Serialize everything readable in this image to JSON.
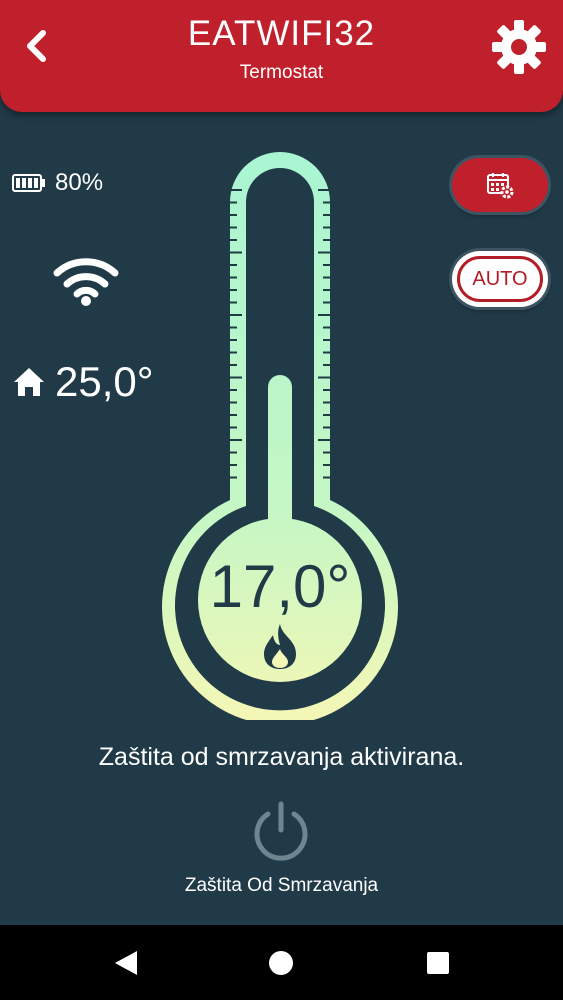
{
  "header": {
    "title": "EATWIFI32",
    "subtitle": "Termostat",
    "back_icon": "chevron-left-icon",
    "settings_icon": "gear-icon"
  },
  "status": {
    "battery_level": "80%",
    "wifi_icon": "wifi-icon",
    "room_temperature": "25,0°"
  },
  "thermostat": {
    "set_temperature": "17,0°",
    "heating_icon": "flame-icon"
  },
  "controls": {
    "schedule_icon": "calendar-gear-icon",
    "mode_label": "AUTO"
  },
  "message": "Zaštita od smrzavanja aktivirana.",
  "power": {
    "label": "Zaštita Od Smrzavanja"
  },
  "colors": {
    "accent": "#c0202c",
    "background": "#213a47",
    "thermo_top": "#a8f5d3",
    "thermo_bottom": "#f4f7b6"
  }
}
